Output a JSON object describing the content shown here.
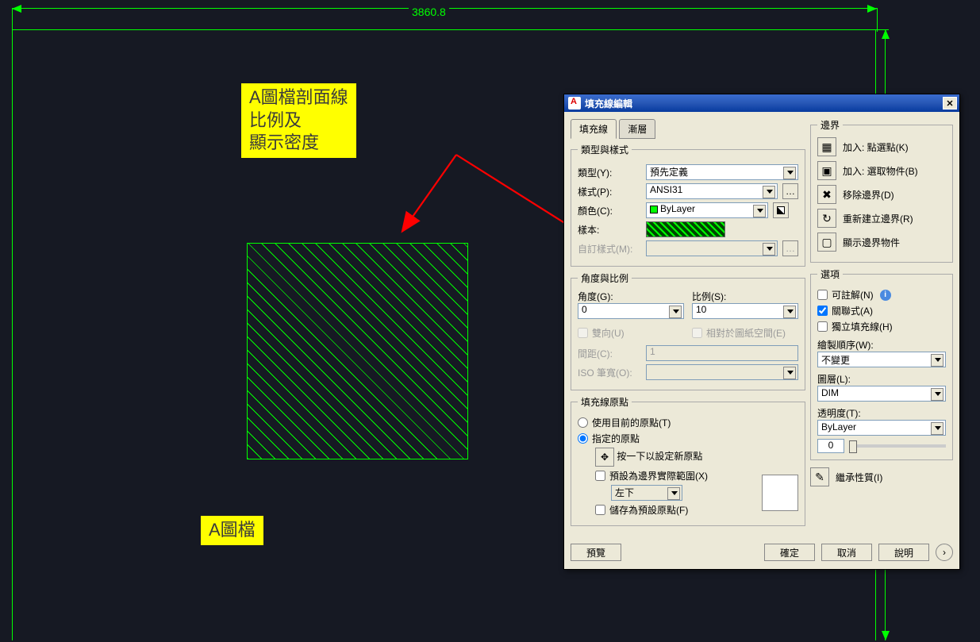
{
  "dimension": {
    "horizontal_value": "3860.8"
  },
  "note1": {
    "line1": "A圖檔剖面線",
    "line2": "比例及",
    "line3": "顯示密度"
  },
  "note2": {
    "text": "A圖檔"
  },
  "dialog": {
    "title": "填充線編輯",
    "tab_hatch": "填充線",
    "tab_gradient": "漸層",
    "grp_type": {
      "legend": "類型與樣式",
      "type_label": "類型(Y):",
      "type_value": "預先定義",
      "pattern_label": "樣式(P):",
      "pattern_value": "ANSI31",
      "color_label": "顏色(C):",
      "color_value": "ByLayer",
      "sample_label": "樣本:",
      "custom_label": "自訂樣式(M):"
    },
    "grp_angle": {
      "legend": "角度與比例",
      "angle_label": "角度(G):",
      "angle_value": "0",
      "scale_label": "比例(S):",
      "scale_value": "10",
      "double_label": "雙向(U)",
      "paper_label": "相對於圖紙空間(E)",
      "spacing_label": "間距(C):",
      "spacing_value": "1",
      "isopen_label": "ISO 筆寬(O):"
    },
    "grp_origin": {
      "legend": "填充線原點",
      "use_current": "使用目前的原點(T)",
      "specified": "指定的原點",
      "click_set": "按一下以設定新原點",
      "default_ext": "預設為邊界實際範圍(X)",
      "ext_value": "左下",
      "store_default": "儲存為預設原點(F)"
    },
    "grp_boundary": {
      "legend": "邊界",
      "add_pick": "加入: 點選點(K)",
      "add_select": "加入: 選取物件(B)",
      "remove": "移除邊界(D)",
      "recreate": "重新建立邊界(R)",
      "display": "顯示邊界物件"
    },
    "grp_options": {
      "legend": "選項",
      "annotative": "可註解(N)",
      "associative": "關聯式(A)",
      "separate": "獨立填充線(H)",
      "draw_order_label": "繪製順序(W):",
      "draw_order_value": "不變更",
      "layer_label": "圖層(L):",
      "layer_value": "DIM",
      "trans_label": "透明度(T):",
      "trans_combo": "ByLayer",
      "trans_num": "0",
      "inherit": "繼承性質(I)"
    },
    "buttons": {
      "preview": "預覽",
      "ok": "確定",
      "cancel": "取消",
      "help": "說明"
    }
  }
}
